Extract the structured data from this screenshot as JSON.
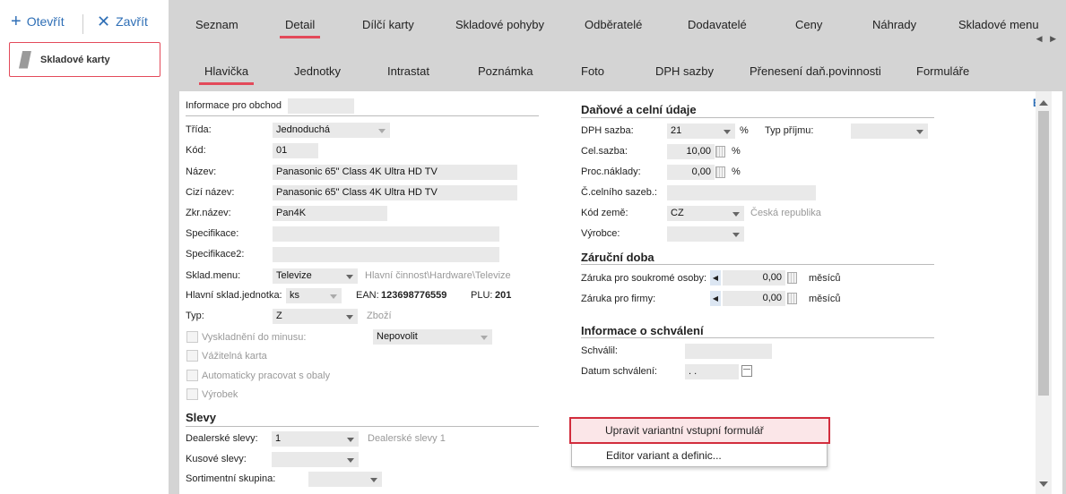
{
  "toolbar": {
    "open_label": "Otevřít",
    "close_label": "Zavřít"
  },
  "nav": {
    "item_label": "Skladové karty"
  },
  "tabs_main": [
    "Seznam",
    "Detail",
    "Dílčí karty",
    "Skladové pohyby",
    "Odběratelé",
    "Dodavatelé",
    "Ceny",
    "Náhrady",
    "Skladové menu"
  ],
  "tabs_sub": [
    "Hlavička",
    "Jednotky",
    "Intrastat",
    "Poznámka",
    "Foto",
    "DPH sazby",
    "Přenesení daň.povinnosti",
    "Formuláře"
  ],
  "form": {
    "info_obchod_label": "Informace pro obchod",
    "trida_label": "Třída:",
    "trida_value": "Jednoduchá",
    "kod_label": "Kód:",
    "kod_value": "01",
    "nazev_label": "Název:",
    "nazev_value": "Panasonic 65\" Class 4K Ultra HD TV",
    "cizi_nazev_label": "Cizí název:",
    "cizi_nazev_value": "Panasonic 65\" Class 4K Ultra HD TV",
    "zkr_nazev_label": "Zkr.název:",
    "zkr_nazev_value": "Pan4K",
    "specifikace_label": "Specifikace:",
    "specifikace2_label": "Specifikace2:",
    "sklad_menu_label": "Sklad.menu:",
    "sklad_menu_value": "Televize",
    "sklad_menu_path": "Hlavní činnost\\Hardware\\Televize",
    "hlavni_jednotka_label": "Hlavní sklad.jednotka:",
    "hlavni_jednotka_value": "ks",
    "ean_label": "EAN:",
    "ean_value": "123698776559",
    "plu_label": "PLU:",
    "plu_value": "201",
    "typ_label": "Typ:",
    "typ_value": "Z",
    "typ_desc": "Zboží",
    "vyskladneni_label": "Vyskladnění do minusu:",
    "vyskladneni_value": "Nepovolit",
    "vazitelna_label": "Vážitelná karta",
    "obaly_label": "Automaticky pracovat s obaly",
    "vyrobek_label": "Výrobek"
  },
  "slevy": {
    "title": "Slevy",
    "dealerske_label": "Dealerské slevy:",
    "dealerske_value": "1",
    "dealerske_desc": "Dealerské slevy 1",
    "kusove_label": "Kusové slevy:",
    "sortiment_label": "Sortimentní skupina:"
  },
  "danove": {
    "title": "Daňové a celní údaje",
    "dph_label": "DPH sazba:",
    "dph_value": "21",
    "dph_unit": "%",
    "typ_prijmu_label": "Typ příjmu:",
    "cel_sazba_label": "Cel.sazba:",
    "cel_sazba_value": "10,00",
    "cel_unit": "%",
    "proc_naklady_label": "Proc.náklady:",
    "proc_naklady_value": "0,00",
    "proc_unit": "%",
    "celni_sazeb_label": "Č.celního sazeb.:",
    "kod_zeme_label": "Kód země:",
    "kod_zeme_value": "CZ",
    "zeme_name": "Česká republika",
    "vyrobce_label": "Výrobce:"
  },
  "zarucni": {
    "title": "Záruční doba",
    "soukrome_label": "Záruka pro soukromé osoby:",
    "soukrome_value": "0,00",
    "soukrome_unit": "měsíců",
    "firmy_label": "Záruka pro firmy:",
    "firmy_value": "0,00",
    "firmy_unit": "měsíců"
  },
  "schvaleni": {
    "title": "Informace o schválení",
    "schvalil_label": "Schválil:",
    "datum_label": "Datum schválení:",
    "datum_value": ". ."
  },
  "context_menu": {
    "item1": "Upravit variantní vstupní formulář",
    "item2": "Editor variant a definic..."
  }
}
